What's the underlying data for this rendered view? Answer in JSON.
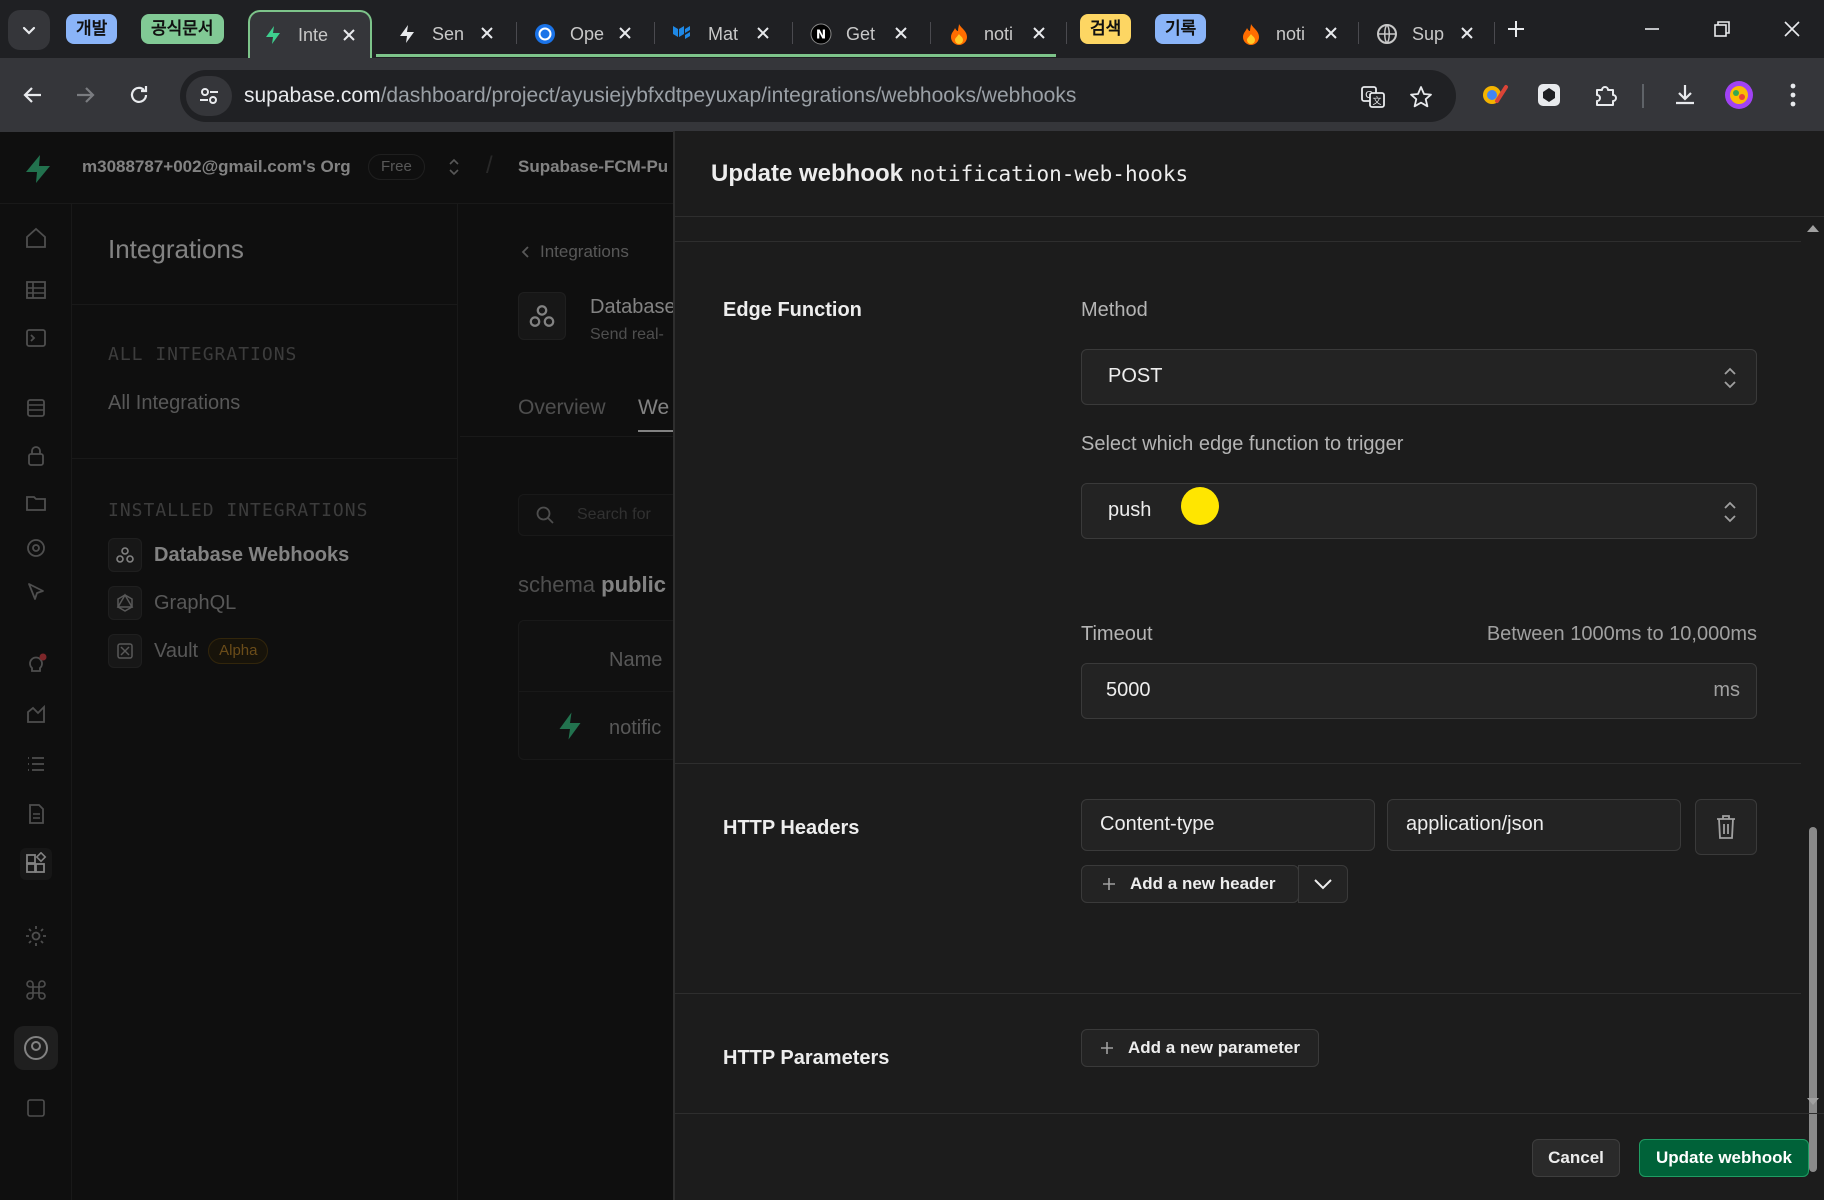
{
  "browser": {
    "groups": [
      {
        "label": "개발",
        "color": "#8ab4f8"
      },
      {
        "label": "공식문서",
        "color": "#81c995"
      },
      {
        "label": "검색",
        "color": "#fdd663"
      },
      {
        "label": "기록",
        "color": "#8ab4f8"
      }
    ],
    "tabs": [
      {
        "title": "Inte",
        "icon": "supabase-icon"
      },
      {
        "title": "Sen",
        "icon": "supabase-icon"
      },
      {
        "title": "Ope",
        "icon": "openai-icon"
      },
      {
        "title": "Mat",
        "icon": "mui-icon"
      },
      {
        "title": "Get",
        "icon": "nextjs-icon"
      },
      {
        "title": "noti",
        "icon": "firebase-icon"
      },
      {
        "title": "noti",
        "icon": "firebase-icon"
      },
      {
        "title": "Sup",
        "icon": "globe-icon"
      }
    ],
    "url_host": "supabase.com",
    "url_path": "/dashboard/project/ayusiejybfxdtpeyuxap/integrations/webhooks/webhooks"
  },
  "app": {
    "org": "m3088787+002@gmail.com's Org",
    "plan": "Free",
    "project": "Supabase-FCM-Pu",
    "sidebar_title": "Integrations",
    "all_header": "ALL INTEGRATIONS",
    "all_item": "All Integrations",
    "installed_header": "INSTALLED INTEGRATIONS",
    "installed": [
      {
        "label": "Database Webhooks"
      },
      {
        "label": "GraphQL"
      },
      {
        "label": "Vault",
        "badge": "Alpha"
      }
    ],
    "back_link": "Integrations",
    "page_title": "Database",
    "page_sub": "Send real-",
    "tabs": [
      "Overview",
      "We"
    ],
    "search_placeholder": "Search for",
    "schema_label": "schema",
    "schema_value": "public",
    "table_col": "Name",
    "row_name": "notific"
  },
  "panel": {
    "title": "Update webhook",
    "webhook_name": "notification-web-hooks",
    "edge_section": "Edge Function",
    "method_label": "Method",
    "method_value": "POST",
    "function_label": "Select which edge function to trigger",
    "function_value": "push",
    "timeout_label": "Timeout",
    "timeout_hint": "Between 1000ms to 10,000ms",
    "timeout_value": "5000",
    "timeout_unit": "ms",
    "headers_section": "HTTP Headers",
    "header_key": "Content-type",
    "header_value": "application/json",
    "add_header": "Add a new header",
    "params_section": "HTTP Parameters",
    "add_param": "Add a new parameter",
    "cancel": "Cancel",
    "submit": "Update webhook"
  },
  "colors": {
    "accent": "#3ecf8e",
    "primary_button": "#006239",
    "cursor_highlight": "#ffe600"
  }
}
